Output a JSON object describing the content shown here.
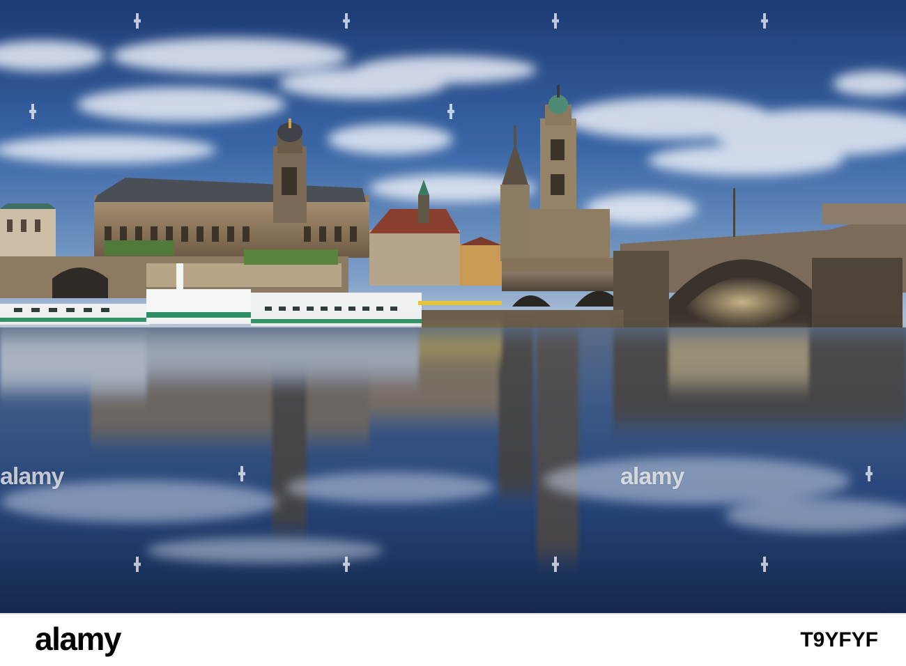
{
  "watermark": {
    "text": "alamy",
    "positions_count": 3
  },
  "footer": {
    "logo_text": "alamy",
    "image_code": "T9YFYF"
  },
  "colors": {
    "sky_top": "#1f3f7a",
    "sky_mid": "#3d69a8",
    "cloud": "#e8eef7",
    "stone": "#9c8466",
    "stone_dark": "#5b4a3a",
    "river": "#223a62",
    "boat_hull": "#f2f4f3",
    "boat_stripe": "#2e8f63"
  }
}
